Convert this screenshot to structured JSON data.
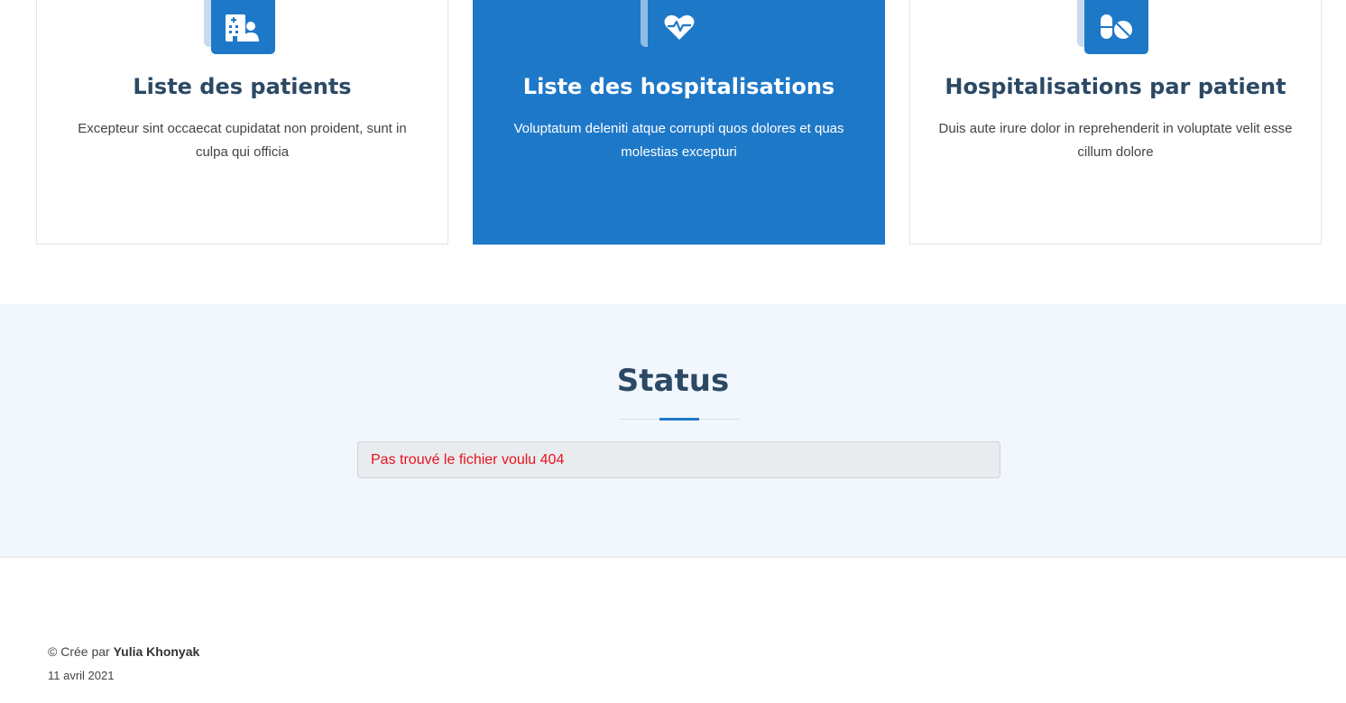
{
  "services": {
    "cards": [
      {
        "title": "Liste des patients",
        "description": "Excepteur sint occaecat cupidatat non proident, sunt in culpa qui officia",
        "icon": "hospital-user-icon"
      },
      {
        "title": "Liste des hospitalisations",
        "description": "Voluptatum deleniti atque corrupti quos dolores et quas molestias excepturi",
        "icon": "heartbeat-icon"
      },
      {
        "title": "Hospitalisations par patient",
        "description": "Duis aute irure dolor in reprehenderit in voluptate velit esse cillum dolore",
        "icon": "pills-icon"
      }
    ]
  },
  "status": {
    "title": "Status",
    "message": "Pas trouvé le fichier voulu 404"
  },
  "footer": {
    "copyright_prefix": "© Crée par ",
    "author": "Yulia Khonyak",
    "date": "11 avril 2021"
  },
  "colors": {
    "accent": "#1e78c8",
    "heading": "#2c4964",
    "error": "#e8111c",
    "section_bg": "#f1f7fd"
  }
}
